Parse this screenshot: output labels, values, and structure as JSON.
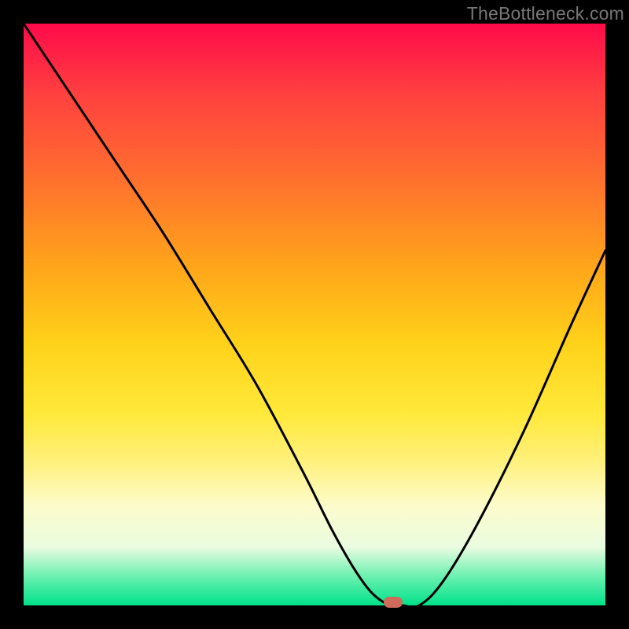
{
  "watermark": "TheBottleneck.com",
  "chart_data": {
    "type": "line",
    "title": "",
    "xlabel": "",
    "ylabel": "",
    "xlim": [
      0,
      100
    ],
    "ylim": [
      0,
      100
    ],
    "x": [
      0,
      8,
      16,
      24,
      32,
      40,
      48,
      53,
      57,
      60,
      63,
      65,
      68,
      72,
      78,
      86,
      94,
      100
    ],
    "values": [
      100,
      88,
      76,
      64,
      51,
      38,
      23,
      13,
      6,
      2,
      0,
      0,
      0,
      4,
      14,
      30,
      48,
      61
    ],
    "marker": {
      "x": 63.5,
      "y": 0.5,
      "color": "#d06a5a"
    },
    "grid": false
  }
}
